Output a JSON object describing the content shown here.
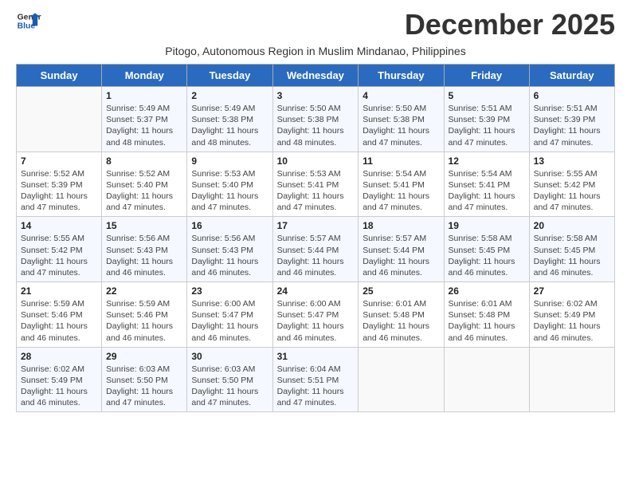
{
  "logo": {
    "line1": "General",
    "line2": "Blue"
  },
  "title": "December 2025",
  "subtitle": "Pitogo, Autonomous Region in Muslim Mindanao, Philippines",
  "days_of_week": [
    "Sunday",
    "Monday",
    "Tuesday",
    "Wednesday",
    "Thursday",
    "Friday",
    "Saturday"
  ],
  "weeks": [
    [
      {
        "day": "",
        "info": ""
      },
      {
        "day": "1",
        "info": "Sunrise: 5:49 AM\nSunset: 5:37 PM\nDaylight: 11 hours\nand 48 minutes."
      },
      {
        "day": "2",
        "info": "Sunrise: 5:49 AM\nSunset: 5:38 PM\nDaylight: 11 hours\nand 48 minutes."
      },
      {
        "day": "3",
        "info": "Sunrise: 5:50 AM\nSunset: 5:38 PM\nDaylight: 11 hours\nand 48 minutes."
      },
      {
        "day": "4",
        "info": "Sunrise: 5:50 AM\nSunset: 5:38 PM\nDaylight: 11 hours\nand 47 minutes."
      },
      {
        "day": "5",
        "info": "Sunrise: 5:51 AM\nSunset: 5:39 PM\nDaylight: 11 hours\nand 47 minutes."
      },
      {
        "day": "6",
        "info": "Sunrise: 5:51 AM\nSunset: 5:39 PM\nDaylight: 11 hours\nand 47 minutes."
      }
    ],
    [
      {
        "day": "7",
        "info": "Sunrise: 5:52 AM\nSunset: 5:39 PM\nDaylight: 11 hours\nand 47 minutes."
      },
      {
        "day": "8",
        "info": "Sunrise: 5:52 AM\nSunset: 5:40 PM\nDaylight: 11 hours\nand 47 minutes."
      },
      {
        "day": "9",
        "info": "Sunrise: 5:53 AM\nSunset: 5:40 PM\nDaylight: 11 hours\nand 47 minutes."
      },
      {
        "day": "10",
        "info": "Sunrise: 5:53 AM\nSunset: 5:41 PM\nDaylight: 11 hours\nand 47 minutes."
      },
      {
        "day": "11",
        "info": "Sunrise: 5:54 AM\nSunset: 5:41 PM\nDaylight: 11 hours\nand 47 minutes."
      },
      {
        "day": "12",
        "info": "Sunrise: 5:54 AM\nSunset: 5:41 PM\nDaylight: 11 hours\nand 47 minutes."
      },
      {
        "day": "13",
        "info": "Sunrise: 5:55 AM\nSunset: 5:42 PM\nDaylight: 11 hours\nand 47 minutes."
      }
    ],
    [
      {
        "day": "14",
        "info": "Sunrise: 5:55 AM\nSunset: 5:42 PM\nDaylight: 11 hours\nand 47 minutes."
      },
      {
        "day": "15",
        "info": "Sunrise: 5:56 AM\nSunset: 5:43 PM\nDaylight: 11 hours\nand 46 minutes."
      },
      {
        "day": "16",
        "info": "Sunrise: 5:56 AM\nSunset: 5:43 PM\nDaylight: 11 hours\nand 46 minutes."
      },
      {
        "day": "17",
        "info": "Sunrise: 5:57 AM\nSunset: 5:44 PM\nDaylight: 11 hours\nand 46 minutes."
      },
      {
        "day": "18",
        "info": "Sunrise: 5:57 AM\nSunset: 5:44 PM\nDaylight: 11 hours\nand 46 minutes."
      },
      {
        "day": "19",
        "info": "Sunrise: 5:58 AM\nSunset: 5:45 PM\nDaylight: 11 hours\nand 46 minutes."
      },
      {
        "day": "20",
        "info": "Sunrise: 5:58 AM\nSunset: 5:45 PM\nDaylight: 11 hours\nand 46 minutes."
      }
    ],
    [
      {
        "day": "21",
        "info": "Sunrise: 5:59 AM\nSunset: 5:46 PM\nDaylight: 11 hours\nand 46 minutes."
      },
      {
        "day": "22",
        "info": "Sunrise: 5:59 AM\nSunset: 5:46 PM\nDaylight: 11 hours\nand 46 minutes."
      },
      {
        "day": "23",
        "info": "Sunrise: 6:00 AM\nSunset: 5:47 PM\nDaylight: 11 hours\nand 46 minutes."
      },
      {
        "day": "24",
        "info": "Sunrise: 6:00 AM\nSunset: 5:47 PM\nDaylight: 11 hours\nand 46 minutes."
      },
      {
        "day": "25",
        "info": "Sunrise: 6:01 AM\nSunset: 5:48 PM\nDaylight: 11 hours\nand 46 minutes."
      },
      {
        "day": "26",
        "info": "Sunrise: 6:01 AM\nSunset: 5:48 PM\nDaylight: 11 hours\nand 46 minutes."
      },
      {
        "day": "27",
        "info": "Sunrise: 6:02 AM\nSunset: 5:49 PM\nDaylight: 11 hours\nand 46 minutes."
      }
    ],
    [
      {
        "day": "28",
        "info": "Sunrise: 6:02 AM\nSunset: 5:49 PM\nDaylight: 11 hours\nand 46 minutes."
      },
      {
        "day": "29",
        "info": "Sunrise: 6:03 AM\nSunset: 5:50 PM\nDaylight: 11 hours\nand 47 minutes."
      },
      {
        "day": "30",
        "info": "Sunrise: 6:03 AM\nSunset: 5:50 PM\nDaylight: 11 hours\nand 47 minutes."
      },
      {
        "day": "31",
        "info": "Sunrise: 6:04 AM\nSunset: 5:51 PM\nDaylight: 11 hours\nand 47 minutes."
      },
      {
        "day": "",
        "info": ""
      },
      {
        "day": "",
        "info": ""
      },
      {
        "day": "",
        "info": ""
      }
    ]
  ]
}
